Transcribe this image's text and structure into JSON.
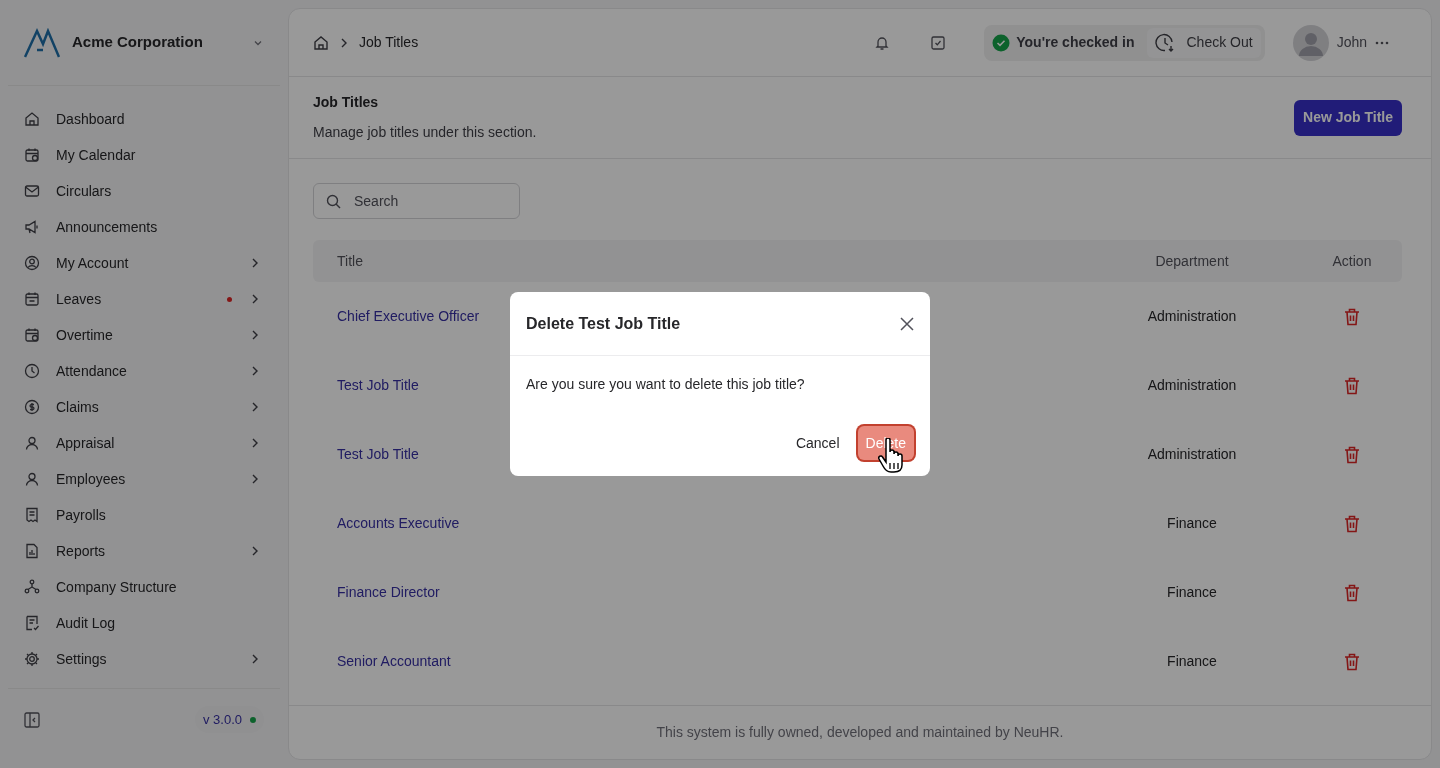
{
  "company": {
    "name": "Acme Corporation"
  },
  "sidebar": {
    "items": [
      {
        "label": "Dashboard",
        "submenu": false,
        "notification": false
      },
      {
        "label": "My Calendar",
        "submenu": false,
        "notification": false
      },
      {
        "label": "Circulars",
        "submenu": false,
        "notification": false
      },
      {
        "label": "Announcements",
        "submenu": false,
        "notification": false
      },
      {
        "label": "My Account",
        "submenu": true,
        "notification": false
      },
      {
        "label": "Leaves",
        "submenu": true,
        "notification": true
      },
      {
        "label": "Overtime",
        "submenu": true,
        "notification": false
      },
      {
        "label": "Attendance",
        "submenu": true,
        "notification": false
      },
      {
        "label": "Claims",
        "submenu": true,
        "notification": false
      },
      {
        "label": "Appraisal",
        "submenu": true,
        "notification": false
      },
      {
        "label": "Employees",
        "submenu": true,
        "notification": false
      },
      {
        "label": "Payrolls",
        "submenu": false,
        "notification": false
      },
      {
        "label": "Reports",
        "submenu": true,
        "notification": false
      },
      {
        "label": "Company Structure",
        "submenu": false,
        "notification": false
      },
      {
        "label": "Audit Log",
        "submenu": false,
        "notification": false
      },
      {
        "label": "Settings",
        "submenu": true,
        "notification": false
      }
    ],
    "version": "v 3.0.0"
  },
  "breadcrumb": [
    "Job Titles"
  ],
  "topbar": {
    "status": "You're checked in",
    "check_out": "Check Out",
    "user": "John"
  },
  "page": {
    "title": "Job Titles",
    "subtitle": "Manage job titles under this section.",
    "new_button": "New Job Title"
  },
  "search": {
    "placeholder": "Search"
  },
  "table": {
    "columns": [
      "Title",
      "Department",
      "Action"
    ],
    "rows": [
      {
        "title": "Chief Executive Officer",
        "department": "Administration"
      },
      {
        "title": "Test Job Title",
        "department": "Administration"
      },
      {
        "title": "Test Job Title",
        "department": "Administration"
      },
      {
        "title": "Accounts Executive",
        "department": "Finance"
      },
      {
        "title": "Finance Director",
        "department": "Finance"
      },
      {
        "title": "Senior Accountant",
        "department": "Finance"
      }
    ]
  },
  "footer": "This system is fully owned, developed and maintained by NeuHR.",
  "dialog": {
    "title": "Delete Test Job Title",
    "message": "Are you sure you want to delete this job title?",
    "cancel": "Cancel",
    "confirm": "Delete"
  }
}
